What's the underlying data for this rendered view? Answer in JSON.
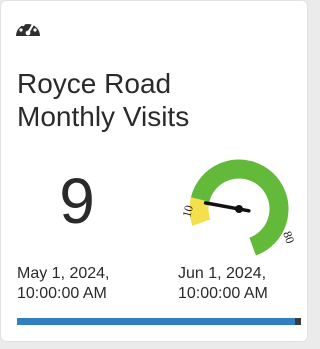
{
  "widget": {
    "icon": "speedometer-icon",
    "title_line1": "Royce Road",
    "title_line2": "Monthly Visits",
    "value": "9",
    "start_date_line1": "May 1, 2024,",
    "start_date_line2": "10:00:00 AM",
    "end_date_line1": "Jun 1, 2024,",
    "end_date_line2": "10:00:00 AM",
    "progress_fraction": 0.98
  },
  "gauge": {
    "min_label": "10",
    "max_label": "80",
    "value": 9,
    "min": 0,
    "max": 80,
    "yellow_end": 10,
    "colors": {
      "yellow": "#f3e04c",
      "green": "#63b93a",
      "needle": "#111111"
    }
  },
  "colors": {
    "progress_fill": "#2f7fc1",
    "progress_track": "#3a3a3a"
  }
}
